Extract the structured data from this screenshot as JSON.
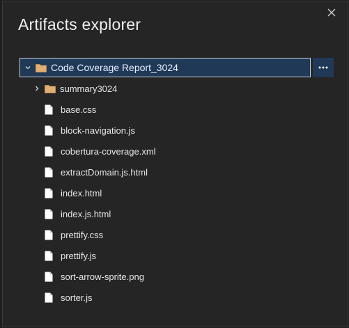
{
  "dialog": {
    "title": "Artifacts explorer"
  },
  "tree": {
    "root": {
      "label": "Code Coverage Report_3024",
      "expanded": true,
      "icon": "folder-icon"
    },
    "folder": {
      "label": "summary3024",
      "expanded": false,
      "icon": "folder-icon"
    },
    "files": [
      {
        "label": "base.css"
      },
      {
        "label": "block-navigation.js"
      },
      {
        "label": "cobertura-coverage.xml"
      },
      {
        "label": "extractDomain.js.html"
      },
      {
        "label": "index.html"
      },
      {
        "label": "index.js.html"
      },
      {
        "label": "prettify.css"
      },
      {
        "label": "prettify.js"
      },
      {
        "label": "sort-arrow-sprite.png"
      },
      {
        "label": "sorter.js"
      }
    ]
  },
  "colors": {
    "selection": "#1f3957",
    "folder": "#e1ae74",
    "background": "#252525"
  }
}
